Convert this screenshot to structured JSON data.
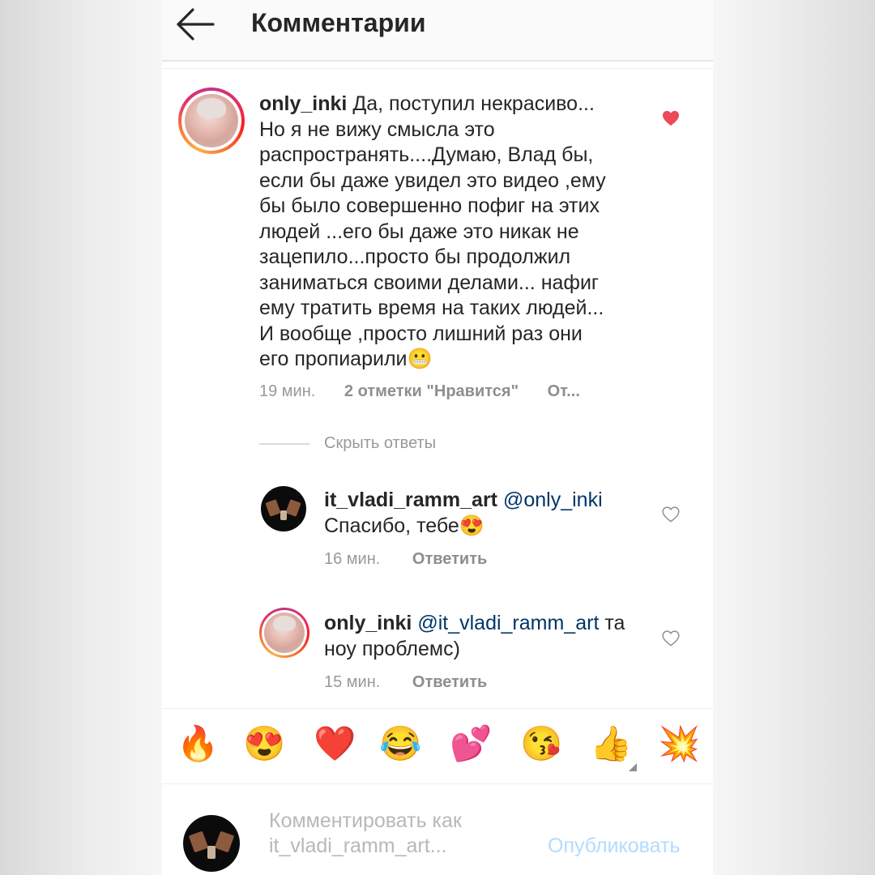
{
  "header": {
    "title": "Комментарии"
  },
  "main_comment": {
    "username": "only_inki",
    "text": "Да, поступил некрасиво...",
    "lines": [
      "Но я не вижу смысла это",
      "распространять....Думаю, Влад бы,",
      "если бы даже увидел это видео ,ему",
      "бы было совершенно пофиг на этих",
      "людей ...его бы даже это никак не",
      "зацепило...просто бы продолжил",
      "заниматься своими делами... нафиг",
      "ему тратить время на таких людей...",
      "И вообще ,просто лишний раз они",
      "его пропиарили"
    ],
    "end_emoji": "😬",
    "time": "19 мин.",
    "likes": "2 отметки \"Нравится\"",
    "reply": "От...",
    "liked": true
  },
  "hide_replies": "Скрыть ответы",
  "replies": [
    {
      "username": "it_vladi_ramm_art",
      "mention": "@only_inki",
      "line2": "Спасибо, тебе",
      "end_emoji": "😍",
      "time": "16 мин.",
      "reply": "Ответить"
    },
    {
      "username": "only_inki",
      "mention": "@it_vladi_ramm_art",
      "after_mention": "та",
      "line2": "ноу проблемс)",
      "time": "15 мин.",
      "reply": "Ответить"
    }
  ],
  "emoji_bar": [
    "🔥",
    "😍",
    "❤️",
    "😂",
    "💕",
    "😘",
    "👍",
    "💥"
  ],
  "composer": {
    "placeholder_line1": "Комментировать как",
    "placeholder_line2": "it_vladi_ramm_art...",
    "publish": "Опубликовать"
  },
  "colors": {
    "heart_liked": "#ed4956",
    "mention": "#003569",
    "publish_disabled": "#b3dbff"
  }
}
